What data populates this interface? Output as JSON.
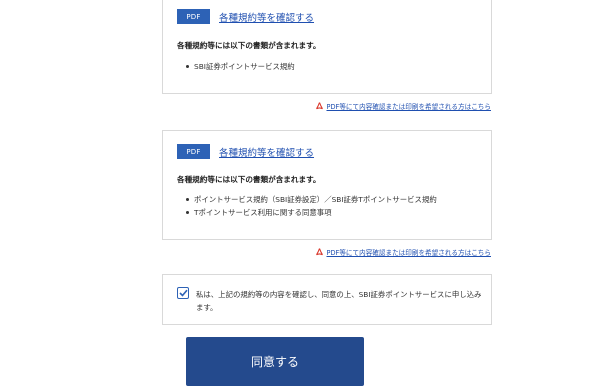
{
  "sections": [
    {
      "badge": "PDF",
      "link": "各種規約等を確認する",
      "contains": "各種規約等には以下の書類が含まれます。",
      "items": [
        "SBI証券ポイントサービス規約"
      ],
      "pdf_note": "PDF等にて内容確認または印刷を希望される方はこちら"
    },
    {
      "badge": "PDF",
      "link": "各種規約等を確認する",
      "contains": "各種規約等には以下の書類が含まれます。",
      "items": [
        "ポイントサービス規約（SBI証券設定）／SBI証券Tポイントサービス規約",
        "Tポイントサービス利用に関する同意事項"
      ],
      "pdf_note": "PDF等にて内容確認または印刷を希望される方はこちら"
    }
  ],
  "agreement": {
    "checked": true,
    "text": "私は、上記の規約等の内容を確認し、同意の上、SBI証券ポイントサービスに申し込みます。"
  },
  "submit_label": "同意する",
  "colors": {
    "accent": "#2d62b6",
    "link": "#1f4fb0",
    "button": "#244a8d",
    "pdf_icon": "#d9372b"
  },
  "icons": {
    "pdf_note_icon": "acrobat-pdf-icon",
    "checkbox_icon": "checkmark-icon"
  }
}
